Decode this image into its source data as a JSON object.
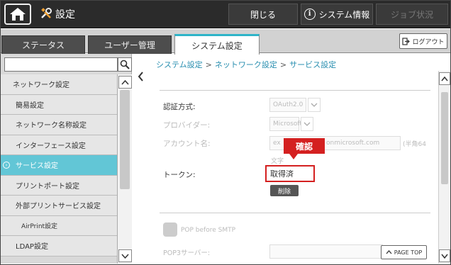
{
  "topbar": {
    "title": "設定",
    "close_label": "閉じる",
    "sysinfo_label": "システム情報",
    "job_label": "ジョブ状況"
  },
  "tabs": [
    {
      "label": "ステータス"
    },
    {
      "label": "ユーザー管理"
    },
    {
      "label": "システム設定"
    }
  ],
  "logout_label": "ログアウト",
  "search": {
    "value": ""
  },
  "sidebar": {
    "items": [
      {
        "label": "ネットワーク設定"
      },
      {
        "label": "簡易設定"
      },
      {
        "label": "ネットワーク名称設定"
      },
      {
        "label": "インターフェース設定"
      },
      {
        "label": "サービス設定"
      },
      {
        "label": "プリントポート設定"
      },
      {
        "label": "外部プリントサービス設定"
      },
      {
        "label": "AirPrint設定"
      },
      {
        "label": "LDAP設定"
      }
    ]
  },
  "breadcrumb": {
    "items": [
      "システム設定",
      "ネットワーク設定",
      "サービス設定"
    ],
    "separator": ">"
  },
  "form": {
    "auth_label": "認証方式:",
    "auth_value": "OAuth2.0",
    "provider_label": "プロバイダー:",
    "provider_value": "Microsoft",
    "account_label": "アカウント名:",
    "account_value_start": "ex",
    "account_value_end": "onmicrosoft.com",
    "account_hint": "(半角64",
    "account_hint_2": "文字",
    "token_label": "トークン:",
    "token_value": "取得済",
    "callout": "確認",
    "delete_label": "削除",
    "pop_label": "POP before SMTP",
    "pop3_label": "POP3サーバー:",
    "pagetop_label": "PAGE TOP"
  },
  "colors": {
    "accent": "#62c6d6",
    "highlight": "#d42020",
    "link": "#2a8fb0"
  }
}
